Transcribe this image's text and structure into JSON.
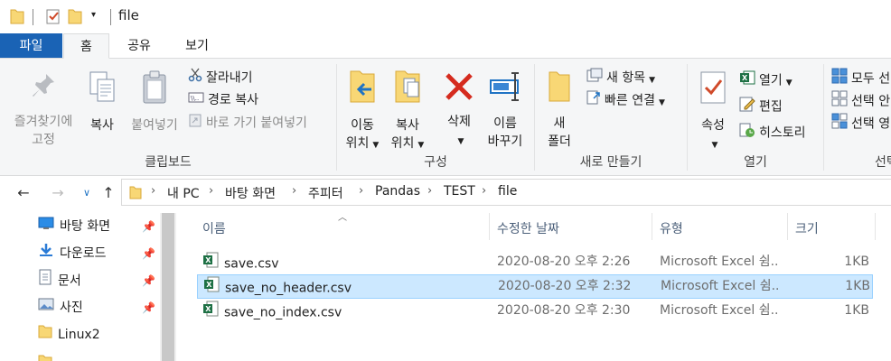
{
  "titlebar": {
    "title": "file",
    "icons": [
      "folder-icon",
      "properties-check-icon",
      "new-folder-icon",
      "customize-qat-icon"
    ]
  },
  "ribbon_tabs": [
    "파일",
    "홈",
    "공유",
    "보기"
  ],
  "ribbon": {
    "clipboard": {
      "group_label": "클립보드",
      "pin_line1": "즐겨찾기에",
      "pin_line2": "고정",
      "copy": "복사",
      "paste": "붙여넣기",
      "cut": "잘라내기",
      "copy_path": "경로 복사",
      "paste_shortcut": "바로 가기 붙여넣기"
    },
    "organize": {
      "group_label": "구성",
      "move_line1": "이동",
      "move_line2": "위치",
      "copyto_line1": "복사",
      "copyto_line2": "위치",
      "delete": "삭제",
      "rename_line1": "이름",
      "rename_line2": "바꾸기"
    },
    "new": {
      "group_label": "새로 만들기",
      "newfolder_line1": "새",
      "newfolder_line2": "폴더",
      "new_item": "새 항목",
      "easy_access": "빠른 연결"
    },
    "open": {
      "group_label": "열기",
      "properties": "속성",
      "open": "열기",
      "edit": "편집",
      "history": "히스토리"
    },
    "select": {
      "group_label": "선택",
      "select_all": "모두 선",
      "select_none": "선택 안",
      "invert": "선택 영"
    }
  },
  "address": {
    "crumbs": [
      "내 PC",
      "바탕 화면",
      "주피터",
      "Pandas",
      "TEST",
      "file"
    ]
  },
  "navpane": {
    "items": [
      {
        "label": "바탕 화면",
        "icon": "desktop-icon",
        "pinned": true
      },
      {
        "label": "다운로드",
        "icon": "download-icon",
        "pinned": true
      },
      {
        "label": "문서",
        "icon": "document-icon",
        "pinned": true
      },
      {
        "label": "사진",
        "icon": "pictures-icon",
        "pinned": true
      },
      {
        "label": "Linux2",
        "icon": "folder-icon",
        "pinned": false
      }
    ]
  },
  "filelist": {
    "columns": [
      "이름",
      "수정한 날짜",
      "유형",
      "크기"
    ],
    "rows": [
      {
        "name": "save.csv",
        "date": "2020-08-20 오후 2:26",
        "type": "Microsoft Excel 쉼...",
        "size": "1KB",
        "selected": false
      },
      {
        "name": "save_no_header.csv",
        "date": "2020-08-20 오후 2:32",
        "type": "Microsoft Excel 쉼...",
        "size": "1KB",
        "selected": true
      },
      {
        "name": "save_no_index.csv",
        "date": "2020-08-20 오후 2:30",
        "type": "Microsoft Excel 쉼...",
        "size": "1KB",
        "selected": false
      }
    ]
  },
  "colors": {
    "file_tab": "#1a63b5",
    "selection": "#cce8ff",
    "selection_border": "#99d1ff",
    "folder": "#f8d775",
    "excel": "#1d7044",
    "delete": "#d52b1e"
  }
}
